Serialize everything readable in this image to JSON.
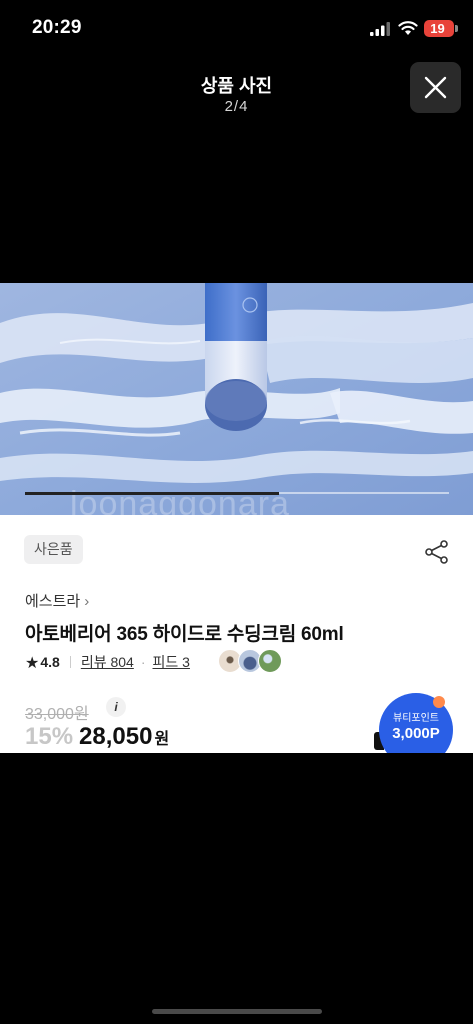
{
  "status_bar": {
    "time": "20:29",
    "battery": "19"
  },
  "viewer": {
    "title": "상품 사진",
    "counter": "2/4",
    "close_icon": "close-icon"
  },
  "photo": {
    "watermark": "loonaggonara",
    "slide_progress": 0.6
  },
  "product": {
    "gift_badge": "사은품",
    "brand": "에스트라",
    "title": "아토베리어 365 하이드로 수딩크림 60ml",
    "rating": "4.8",
    "review_label": "리뷰 804",
    "feed_label": "피드 3",
    "original_price": "33,000원",
    "discount_rate": "15%",
    "sale_price": "28,050",
    "currency": "원",
    "point_label": "뷰티포인트",
    "point_amount": "3,000P"
  },
  "colors": {
    "accent": "#2a5fe6",
    "battery": "#e8433a",
    "cream_blue": "#8ea9dc"
  }
}
